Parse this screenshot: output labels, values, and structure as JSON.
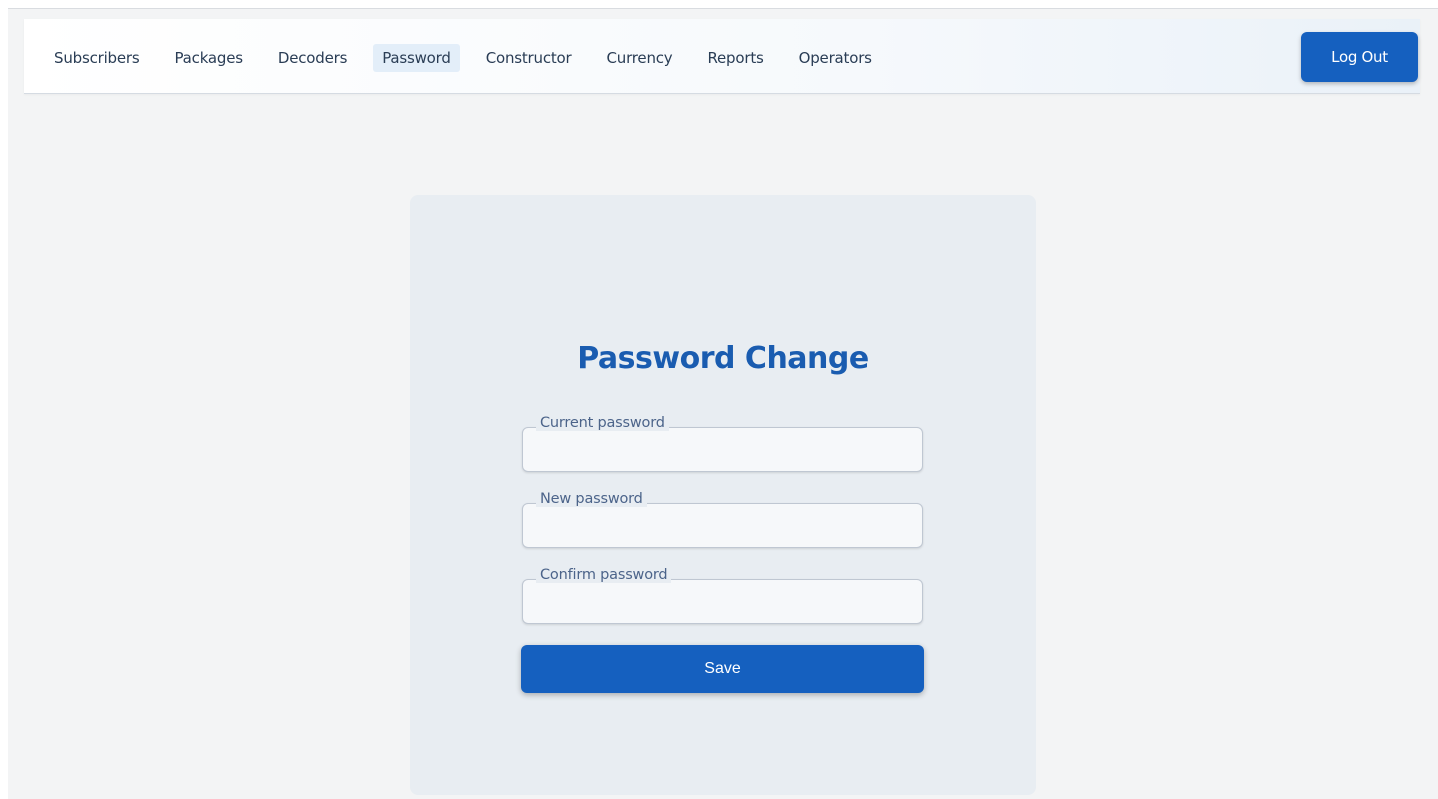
{
  "nav": {
    "items": [
      {
        "label": "Subscribers",
        "active": false
      },
      {
        "label": "Packages",
        "active": false
      },
      {
        "label": "Decoders",
        "active": false
      },
      {
        "label": "Password",
        "active": true
      },
      {
        "label": "Constructor",
        "active": false
      },
      {
        "label": "Currency",
        "active": false
      },
      {
        "label": "Reports",
        "active": false
      },
      {
        "label": "Operators",
        "active": false
      }
    ],
    "logout_label": "Log Out"
  },
  "form": {
    "title": "Password Change",
    "fields": {
      "current": {
        "label": "Current password",
        "value": ""
      },
      "new": {
        "label": "New password",
        "value": ""
      },
      "confirm": {
        "label": "Confirm password",
        "value": ""
      }
    },
    "save_label": "Save"
  },
  "colors": {
    "primary": "#1560bf",
    "title": "#1a5cb0",
    "page_background": "#f3f4f5",
    "card_background": "#e8edf2",
    "active_nav_background": "#e3eef9"
  }
}
